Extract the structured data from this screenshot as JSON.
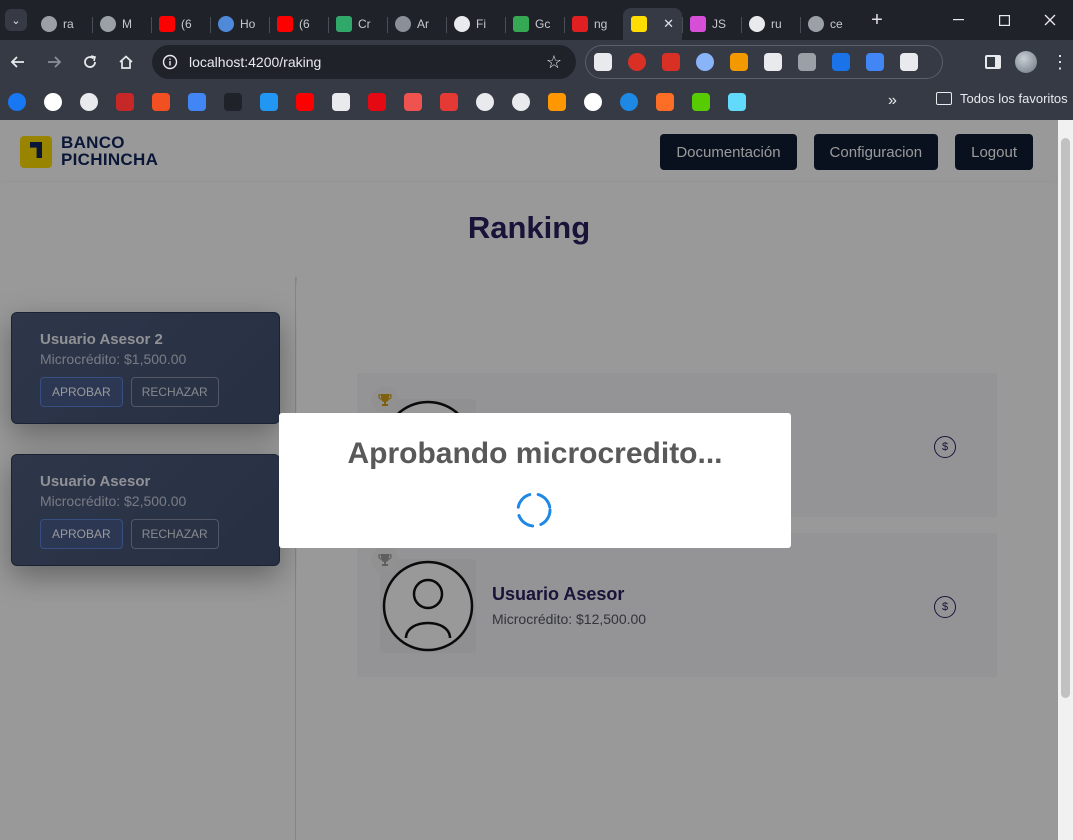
{
  "browser": {
    "tabs": [
      {
        "label": "ra",
        "icon": "chrome-icon",
        "color": "#9aa0a6"
      },
      {
        "label": "M",
        "icon": "gear-icon",
        "color": "#9aa0a6"
      },
      {
        "label": "(6",
        "icon": "youtube-icon",
        "color": "#ff0000"
      },
      {
        "label": "Ho",
        "icon": "web-icon",
        "color": "#4f8ad9"
      },
      {
        "label": "(6",
        "icon": "youtube-icon",
        "color": "#ff0000"
      },
      {
        "label": "Cr",
        "icon": "code-icon",
        "color": "#2fa86a"
      },
      {
        "label": "Ar",
        "icon": "circle-icon",
        "color": "#8a8f98"
      },
      {
        "label": "Fi",
        "icon": "github-icon",
        "color": "#e8eaed"
      },
      {
        "label": "Gc",
        "icon": "meet-icon",
        "color": "#34a853"
      },
      {
        "label": "ng",
        "icon": "n-icon",
        "color": "#e02020"
      },
      {
        "label": "",
        "icon": "banco-icon",
        "color": "#ffdd00",
        "active": true
      },
      {
        "label": "JS",
        "icon": "js-icon",
        "color": "#d64fd6"
      },
      {
        "label": "ru",
        "icon": "github-icon",
        "color": "#e8eaed"
      },
      {
        "label": "ce",
        "icon": "chrome-icon",
        "color": "#9aa0a6"
      }
    ],
    "new_tab_label": "+",
    "close_tab_label": "✕",
    "url": "localhost:4200/raking",
    "bookmarks_folder_label": "Todos los favoritos",
    "bookmarks_more_label": "»",
    "extension_colors": [
      "#e8eaed",
      "#d93025",
      "#d93025",
      "#8ab4f8",
      "#f29900",
      "#e8eaed",
      "#9aa0a6",
      "#1a73e8",
      "#4285f4",
      "#e8eaed"
    ],
    "bookmark_colors": [
      "#1877f2",
      "#ffffff",
      "#e8eaed",
      "#c62828",
      "#f25022",
      "#4285f4",
      "#1f2229",
      "#2196f3",
      "#ff0000",
      "#e8eaed",
      "#e50914",
      "#ef5350",
      "#e53935",
      "#e8eaed",
      "#e8eaed",
      "#ff9800",
      "#ffffff",
      "#1e88e5",
      "#fc6d26",
      "#58cc02",
      "#61dafb"
    ]
  },
  "header": {
    "brand_line1": "BANCO",
    "brand_line2": "PICHINCHA",
    "nav": {
      "documentation": "Documentación",
      "settings": "Configuracion",
      "logout": "Logout"
    }
  },
  "page": {
    "title": "Ranking"
  },
  "requests": [
    {
      "name": "Usuario Asesor 2",
      "amount": "Microcrédito: $1,500.00",
      "approve": "APROBAR",
      "reject": "RECHAZAR"
    },
    {
      "name": "Usuario Asesor",
      "amount": "Microcrédito: $2,500.00",
      "approve": "APROBAR",
      "reject": "RECHAZAR"
    }
  ],
  "ranking": [
    {
      "name": "",
      "amount": "",
      "trophy_color": "#d4a017"
    },
    {
      "name": "Usuario Asesor",
      "amount": "Microcrédito: $12,500.00",
      "trophy_color": "#9e9e9e"
    }
  ],
  "modal": {
    "title": "Aprobando microcredito...",
    "spinner_color": "#1e88e5"
  },
  "colors": {
    "brand_yellow": "#ffdd00",
    "brand_navy": "#0f265c",
    "nav_button_bg": "#0f1c32",
    "title_color": "#2b2060"
  }
}
